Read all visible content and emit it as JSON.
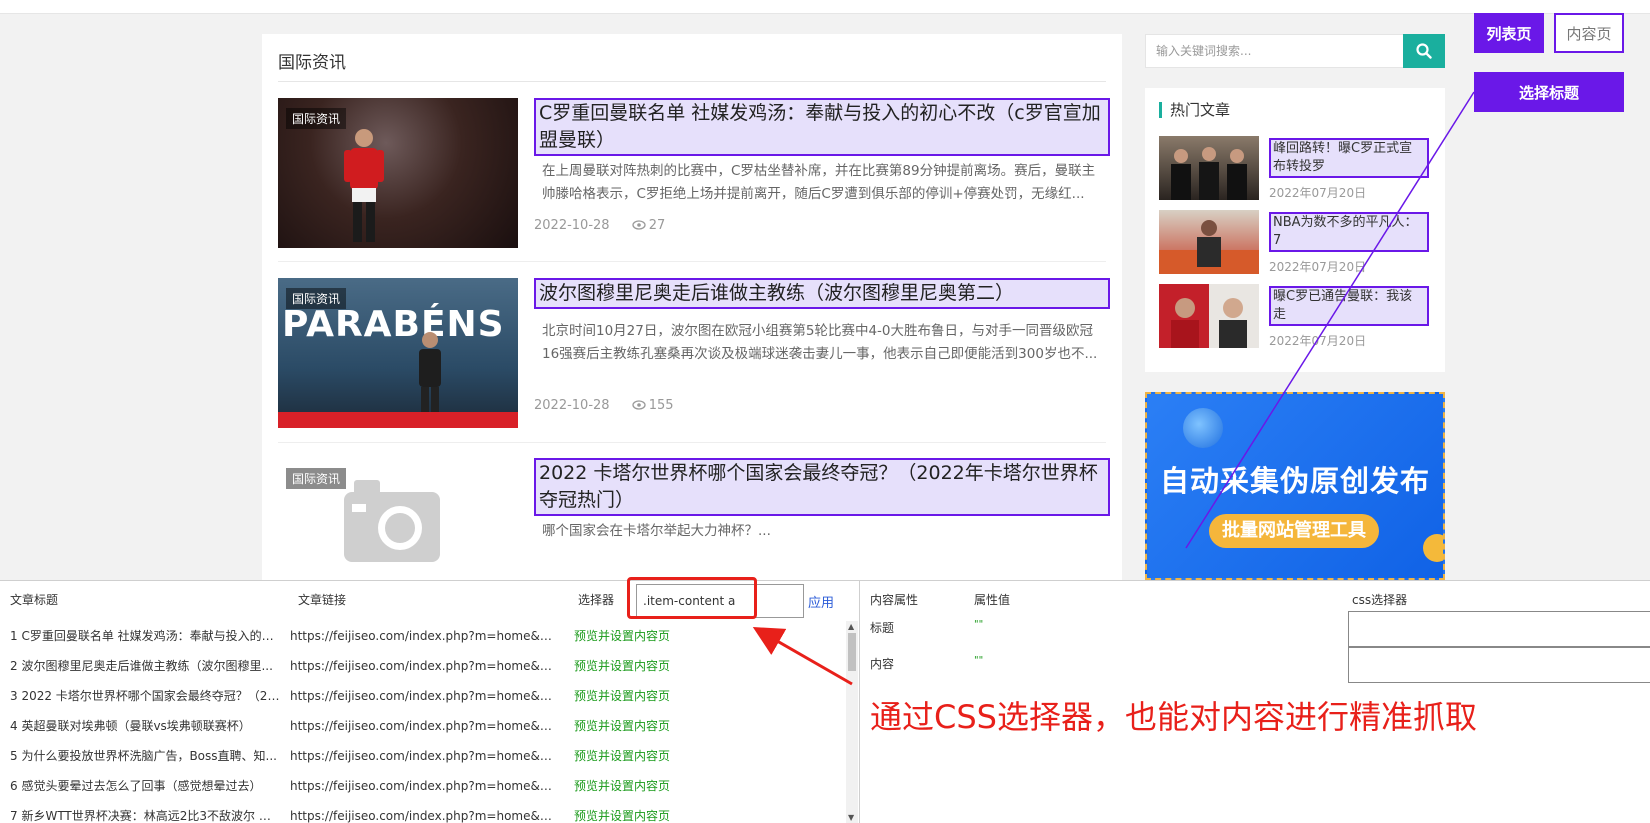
{
  "main": {
    "section_title": "国际资讯",
    "articles": [
      {
        "tag": "国际资讯",
        "title": "C罗重回曼联名单 社媒发鸡汤：奉献与投入的初心不改（c罗官宣加盟曼联）",
        "desc": "在上周曼联对阵热刺的比赛中，C罗枯坐替补席，并在比赛第89分钟提前离场。赛后，曼联主帅滕哈格表示，C罗拒绝上场并提前离开，随后C罗遭到俱乐部的停训+停赛处罚，无缘红...",
        "date": "2022-10-28",
        "views": "27"
      },
      {
        "tag": "国际资讯",
        "thumb_text": "PARABÉNS",
        "title": "波尔图穆里尼奥走后谁做主教练（波尔图穆里尼奥第二）",
        "desc": "北京时间10月27日，波尔图在欧冠小组赛第5轮比赛中4-0大胜布鲁日，与对手一同晋级欧冠16强赛后主教练孔塞桑再次谈及极端球迷袭击妻儿一事，他表示自己即便能活到300岁也不...",
        "date": "2022-10-28",
        "views": "155"
      },
      {
        "tag": "国际资讯",
        "title": "2022 卡塔尔世界杯哪个国家会最终夺冠？（2022年卡塔尔世界杯夺冠热门）",
        "desc": "哪个国家会在卡塔尔举起大力神杯？..."
      }
    ]
  },
  "sidebar": {
    "search_placeholder": "输入关键词搜索...",
    "hot_title": "热门文章",
    "hot_items": [
      {
        "title": "峰回路转！曝C罗正式宣布转投罗",
        "date": "2022年07月20日"
      },
      {
        "title": "NBA为数不多的平凡人：7",
        "date": "2022年07月20日"
      },
      {
        "title": "曝C罗已通告曼联：我该走",
        "date": "2022年07月20日"
      }
    ],
    "banner": {
      "headline": "自动采集伪原创发布",
      "pill": "批量网站管理工具"
    }
  },
  "topright": {
    "list_label": "列表页",
    "content_label": "内容页",
    "select_title_label": "选择标题"
  },
  "tool": {
    "col_title": "文章标题",
    "col_link": "文章链接",
    "selector_label": "选择器",
    "selector_value": ".item-content a",
    "apply_label": "应用",
    "rows": [
      {
        "title": "1 C罗重回曼联名单 社媒发鸡汤：奉献与投入的初...",
        "link": "https://feijiseo.com/index.php?m=home&c=Vie...",
        "action": "预览并设置内容页"
      },
      {
        "title": "2 波尔图穆里尼奥走后谁做主教练（波尔图穆里...",
        "link": "https://feijiseo.com/index.php?m=home&c=Vie...",
        "action": "预览并设置内容页"
      },
      {
        "title": "3 2022 卡塔尔世界杯哪个国家会最终夺冠？（20...",
        "link": "https://feijiseo.com/index.php?m=home&c=Vie...",
        "action": "预览并设置内容页"
      },
      {
        "title": "4 英超曼联对埃弗顿（曼联vs埃弗顿联赛杯）",
        "link": "https://feijiseo.com/index.php?m=home&c=Vie...",
        "action": "预览并设置内容页"
      },
      {
        "title": "5 为什么要投放世界杯洗脑广告，Boss直聘、知...",
        "link": "https://feijiseo.com/index.php?m=home&c=Vie...",
        "action": "预览并设置内容页"
      },
      {
        "title": "6 感觉头要晕过去怎么了回事（感觉想晕过去）",
        "link": "https://feijiseo.com/index.php?m=home&c=Vie...",
        "action": "预览并设置内容页"
      },
      {
        "title": "7 新乡WTT世界杯决赛：林高远2比3不敌波尔 无...",
        "link": "https://feijiseo.com/index.php?m=home&c=Vie...",
        "action": "预览并设置内容页"
      }
    ],
    "prop_head": "内容属性",
    "value_head": "属性值",
    "css_head": "css选择器",
    "props": [
      {
        "label": "标题",
        "value": "\"\""
      },
      {
        "label": "内容",
        "value": "\"\""
      }
    ]
  },
  "annotation": "通过CSS选择器，也能对内容进行精准抓取",
  "colors": {
    "accent": "#6a18e8",
    "highlight_bg": "#e6e0fb",
    "search_button": "#1aaf9e",
    "annotation_red": "#e8201a",
    "action_green": "#1a9a1a"
  }
}
